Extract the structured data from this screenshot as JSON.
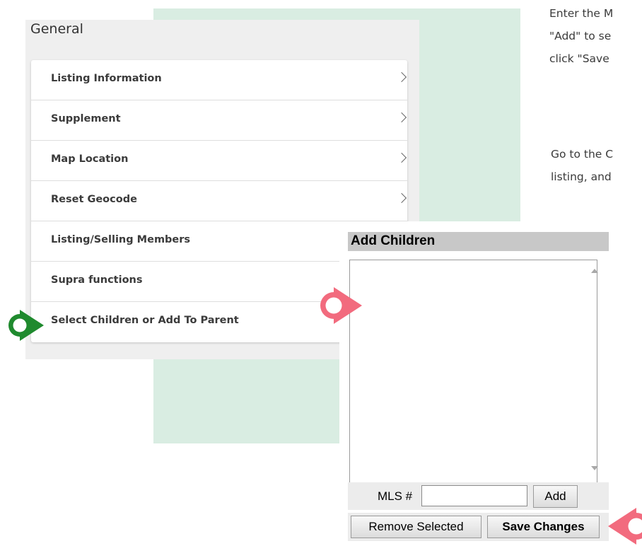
{
  "instructions": {
    "lines_top": [
      "Enter the M",
      "\"Add\" to se",
      "click \"Save"
    ],
    "lines_mid": [
      "Go to the C",
      "listing, and"
    ]
  },
  "general": {
    "title": "General",
    "items": [
      {
        "label": "Listing Information",
        "chevron": true
      },
      {
        "label": "Supplement",
        "chevron": true
      },
      {
        "label": "Map Location",
        "chevron": true
      },
      {
        "label": "Reset Geocode",
        "chevron": true
      },
      {
        "label": "Listing/Selling Members",
        "chevron": false
      },
      {
        "label": "Supra functions",
        "chevron": false
      },
      {
        "label": "Select Children or Add To Parent",
        "chevron": false
      }
    ]
  },
  "dialog": {
    "title": "Add Children",
    "mls_label": "MLS #",
    "mls_value": "",
    "add_label": "Add",
    "remove_label": "Remove Selected",
    "save_label": "Save Changes"
  },
  "colors": {
    "green_panel": "#d9ede2",
    "green_marker": "#1f8a2e",
    "pink_marker": "#f26b7e"
  }
}
